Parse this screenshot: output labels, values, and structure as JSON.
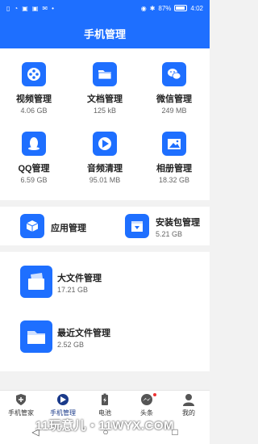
{
  "status_bar": {
    "battery": "87%",
    "time": "4:02"
  },
  "header": {
    "title": "手机管理"
  },
  "grid": [
    {
      "name": "视频管理",
      "size": "4.06 GB",
      "icon": "film-reel-icon"
    },
    {
      "name": "文档管理",
      "size": "125 kB",
      "icon": "folder-icon"
    },
    {
      "name": "微信管理",
      "size": "249 MB",
      "icon": "wechat-icon"
    },
    {
      "name": "QQ管理",
      "size": "6.59 GB",
      "icon": "qq-penguin-icon"
    },
    {
      "name": "音频清理",
      "size": "95.01 MB",
      "icon": "audio-icon"
    },
    {
      "name": "相册管理",
      "size": "18.32 GB",
      "icon": "photo-album-icon"
    }
  ],
  "row2": [
    {
      "name": "应用管理",
      "size": "",
      "icon": "app-cube-icon"
    },
    {
      "name": "安装包管理",
      "size": "5.21 GB",
      "icon": "package-icon"
    }
  ],
  "files": [
    {
      "name": "大文件管理",
      "size": "17.21 GB",
      "icon": "large-file-icon"
    },
    {
      "name": "最近文件管理",
      "size": "2.52 GB",
      "icon": "recent-folder-icon"
    }
  ],
  "tabs": [
    {
      "label": "手机管家",
      "icon": "shield-icon"
    },
    {
      "label": "手机管理",
      "icon": "phone-manage-icon",
      "active": true
    },
    {
      "label": "电池",
      "icon": "battery-icon"
    },
    {
      "label": "头条",
      "icon": "messenger-icon",
      "badge": true
    },
    {
      "label": "我的",
      "icon": "profile-icon"
    }
  ],
  "watermark": "11玩意儿 • 11WYX.COM",
  "colors": {
    "accent": "#1e6fff",
    "background": "#f2f2f2"
  }
}
